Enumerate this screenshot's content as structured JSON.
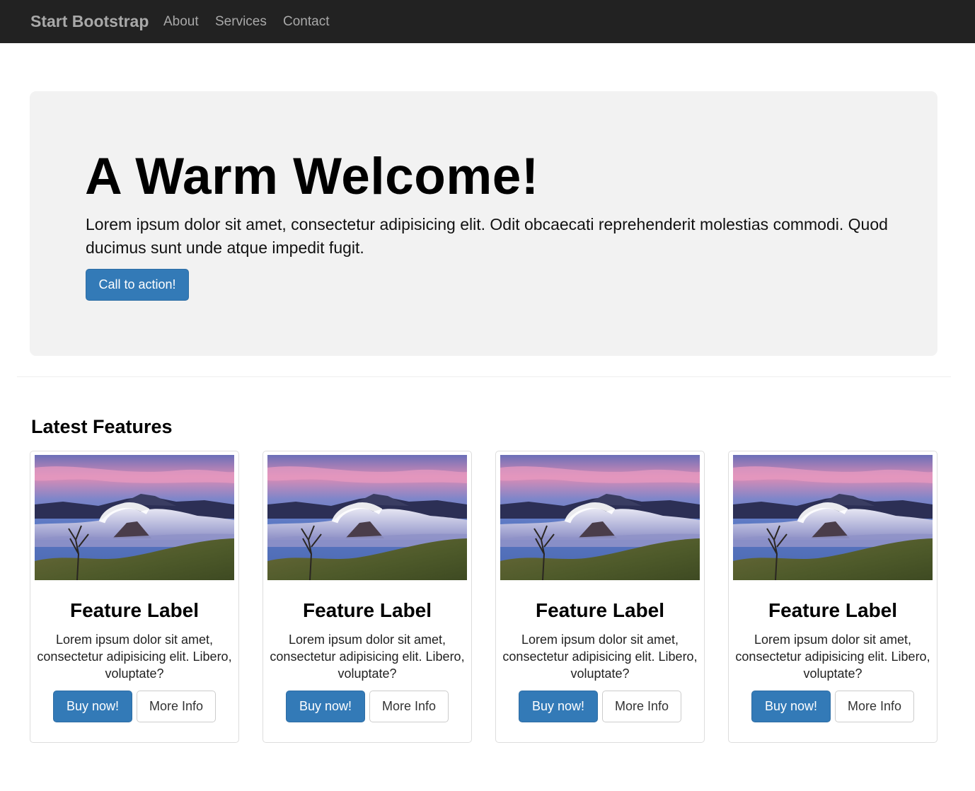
{
  "navbar": {
    "brand": "Start Bootstrap",
    "links": [
      {
        "label": "About"
      },
      {
        "label": "Services"
      },
      {
        "label": "Contact"
      }
    ]
  },
  "hero": {
    "heading": "A Warm Welcome!",
    "text": "Lorem ipsum dolor sit amet, consectetur adipisicing elit. Odit obcaecati reprehenderit molestias commodi. Quod ducimus sunt unde atque impedit fugit.",
    "cta_label": "Call to action!"
  },
  "features": {
    "title": "Latest Features",
    "cards": [
      {
        "label": "Feature Label",
        "text": "Lorem ipsum dolor sit amet, consectetur adipisicing elit. Libero, voluptate?",
        "buy_label": "Buy now!",
        "info_label": "More Info"
      },
      {
        "label": "Feature Label",
        "text": "Lorem ipsum dolor sit amet, consectetur adipisicing elit. Libero, voluptate?",
        "buy_label": "Buy now!",
        "info_label": "More Info"
      },
      {
        "label": "Feature Label",
        "text": "Lorem ipsum dolor sit amet, consectetur adipisicing elit. Libero, voluptate?",
        "buy_label": "Buy now!",
        "info_label": "More Info"
      },
      {
        "label": "Feature Label",
        "text": "Lorem ipsum dolor sit amet, consectetur adipisicing elit. Libero, voluptate?",
        "buy_label": "Buy now!",
        "info_label": "More Info"
      }
    ]
  },
  "colors": {
    "navbar_bg": "#222222",
    "primary": "#337ab7",
    "jumbotron_bg": "#f2f2f2"
  }
}
